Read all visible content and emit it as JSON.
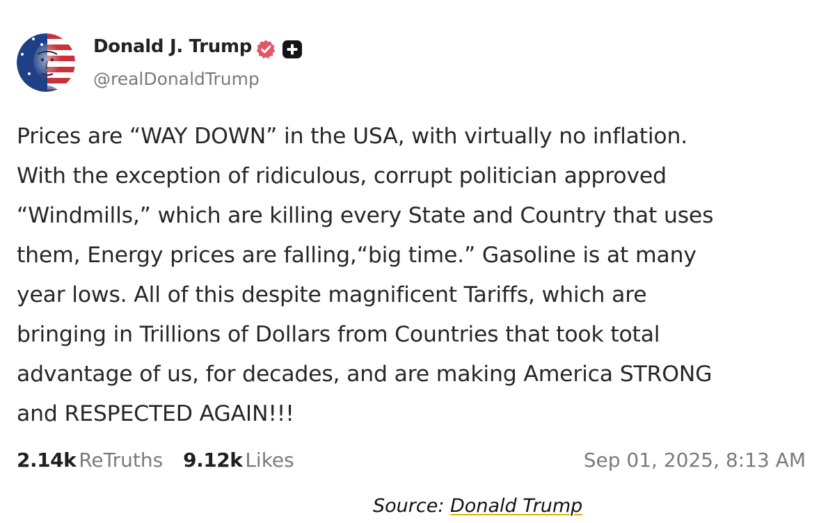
{
  "post": {
    "author": {
      "display_name": "Donald J. Trump",
      "handle": "@realDonaldTrump",
      "avatar_icon": "flag-portrait-avatar",
      "verified_icon": "verified-badge-icon",
      "verified_color": "#e2566b",
      "plus_badge_icon": "plus-badge-icon"
    },
    "body_lines": [
      "Prices are “WAY DOWN” in the USA, with virtually no inflation.",
      "With the exception of ridiculous, corrupt politician approved",
      "“Windmills,” which are killing every State and Country that uses",
      "them, Energy prices are falling,“big time.” Gasoline is at many",
      "year lows. All of this despite magnificent Tariffs, which are",
      "bringing in Trillions of Dollars from Countries that took total",
      "advantage of us, for decades, and are making America STRONG",
      "and RESPECTED AGAIN!!!"
    ],
    "stats": {
      "retruths_count": "2.14k",
      "retruths_label": "ReTruths",
      "likes_count": "9.12k",
      "likes_label": "Likes"
    },
    "timestamp": "Sep 01, 2025, 8:13 AM"
  },
  "caption": {
    "prefix": "Source: ",
    "link_text": "Donald Trump",
    "link_underline_color": "#e0b000"
  }
}
